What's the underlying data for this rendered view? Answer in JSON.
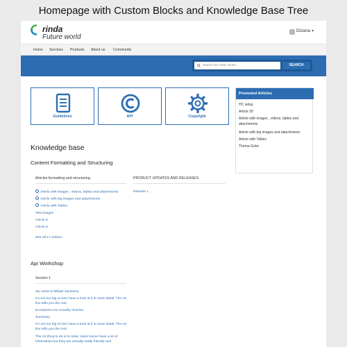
{
  "banner": {
    "title": "Homepage with Custom Blocks and Knowledge Base Tree"
  },
  "header": {
    "logo_name": "rinda",
    "logo_tagline": "Future world",
    "user_name": "Diziana"
  },
  "nav": {
    "items": [
      "Home",
      "Services",
      "Products",
      "About us",
      "Community"
    ]
  },
  "search": {
    "placeholder": "Search our Help Center",
    "button_label": "SEARCH"
  },
  "blocks": [
    {
      "label": "Guidelines",
      "icon": "document-icon"
    },
    {
      "label": "API",
      "icon": "copyright-icon"
    },
    {
      "label": "Copyright",
      "icon": "gear-icon"
    }
  ],
  "promoted": {
    "title": "Promoted Articles",
    "items": [
      "HC setup",
      "Article 30",
      "Article with images , videos, tables and attachments",
      "Article with big images and attachments",
      "Article with Tables",
      "Theme-Golm"
    ]
  },
  "kb": {
    "title": "Knowledge base",
    "section1": {
      "title": "Content Formatting and Structuring",
      "col1": {
        "heading": "Articles formatting and structuring",
        "articles": [
          "Article with images , videos, tables and attachments",
          "Article with big images and attachments",
          "Article with Tables",
          "Test images",
          "Article 9",
          "Article 8"
        ],
        "see_all": "See all 17 articles"
      },
      "col2": {
        "heading": "PRODUCT UPDATES AND RELEASES",
        "articles": [
          "Release 1"
        ]
      }
    },
    "section2": {
      "title": "Api Workshop",
      "col1": {
        "heading": "Section 1",
        "articles": [
          "My name is Mikael Janssens",
          "It's not too big so let's have a look at it in more detail. The rst line tells you the root",
          "Exceptions Are Actually Oracles",
          "Summary",
          "It's not too big so let's have a look at it in more detail. The rst line tells you the root",
          "The rst thing to do is to relax; stack traces have a lot of information but they are actually really friendly and"
        ]
      }
    }
  },
  "colors": {
    "brand": "#2c6db2",
    "logo_green": "#4caf50",
    "logo_blue": "#1e88c7"
  }
}
